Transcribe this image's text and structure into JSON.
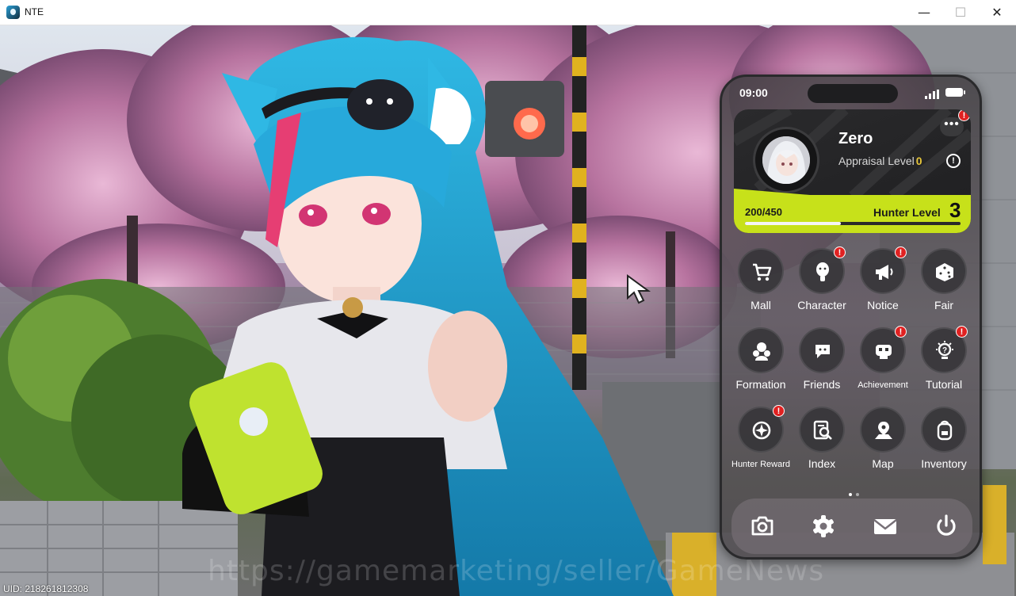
{
  "window": {
    "title": "NTE",
    "min_glyph": "—",
    "max_glyph": "☐",
    "close_glyph": "✕"
  },
  "scene": {
    "watermark": "https://gamemarketing/seller/GameNews",
    "uid": "UID: 218261812308"
  },
  "phone": {
    "status": {
      "time": "09:00"
    },
    "profile": {
      "name": "Zero",
      "appraisal_label": "Appraisal Level",
      "appraisal_level": "0",
      "exp_text": "200/450",
      "exp_fraction": 0.444,
      "hunter_label": "Hunter Level",
      "hunter_level": "3",
      "more_badge": "!"
    },
    "apps": [
      {
        "label": "Mall",
        "icon": "cart-icon",
        "badge": ""
      },
      {
        "label": "Character",
        "icon": "character-icon",
        "badge": "!"
      },
      {
        "label": "Notice",
        "icon": "megaphone-icon",
        "badge": "!"
      },
      {
        "label": "Fair",
        "icon": "dice-icon",
        "badge": ""
      },
      {
        "label": "Formation",
        "icon": "formation-icon",
        "badge": ""
      },
      {
        "label": "Friends",
        "icon": "friends-icon",
        "badge": ""
      },
      {
        "label": "Achievement",
        "icon": "achievement-icon",
        "badge": "!"
      },
      {
        "label": "Tutorial",
        "icon": "lightbulb-icon",
        "badge": "!"
      },
      {
        "label": "Hunter Reward",
        "icon": "hunter-reward-icon",
        "badge": "!"
      },
      {
        "label": "Index",
        "icon": "index-search-icon",
        "badge": ""
      },
      {
        "label": "Map",
        "icon": "map-pin-icon",
        "badge": ""
      },
      {
        "label": "Inventory",
        "icon": "backpack-icon",
        "badge": ""
      }
    ],
    "dock": [
      {
        "name": "camera",
        "icon": "camera-icon"
      },
      {
        "name": "settings",
        "icon": "gear-icon"
      },
      {
        "name": "mail",
        "icon": "mail-icon"
      },
      {
        "name": "power",
        "icon": "power-icon"
      }
    ],
    "accent_color": "#c7e11a"
  }
}
